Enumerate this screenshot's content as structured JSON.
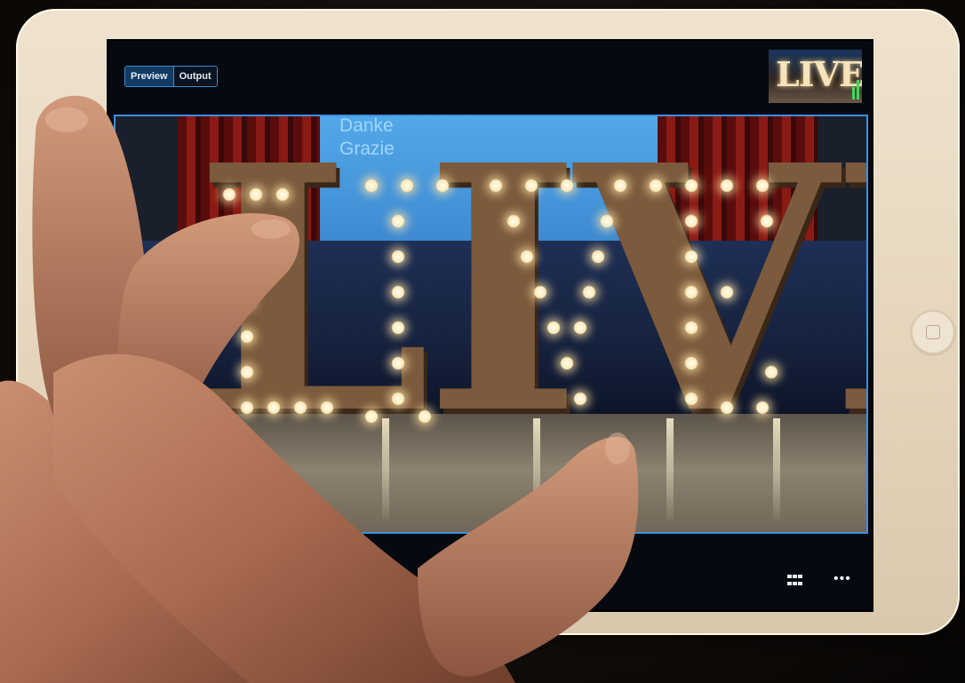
{
  "toolbar": {
    "preview_label": "Preview",
    "output_label": "Output"
  },
  "program_thumbnail": {
    "text": "LIVE"
  },
  "preview": {
    "backdrop_line_1": "Danke",
    "backdrop_line_2": "Grazie",
    "sign_text": "LIVE"
  },
  "icons": {
    "grid": "grid-icon",
    "more": "more-icon"
  },
  "colors": {
    "accent": "#3d8fe0",
    "tablet": "#e6d6bd",
    "screen_bg": "#06090f"
  }
}
